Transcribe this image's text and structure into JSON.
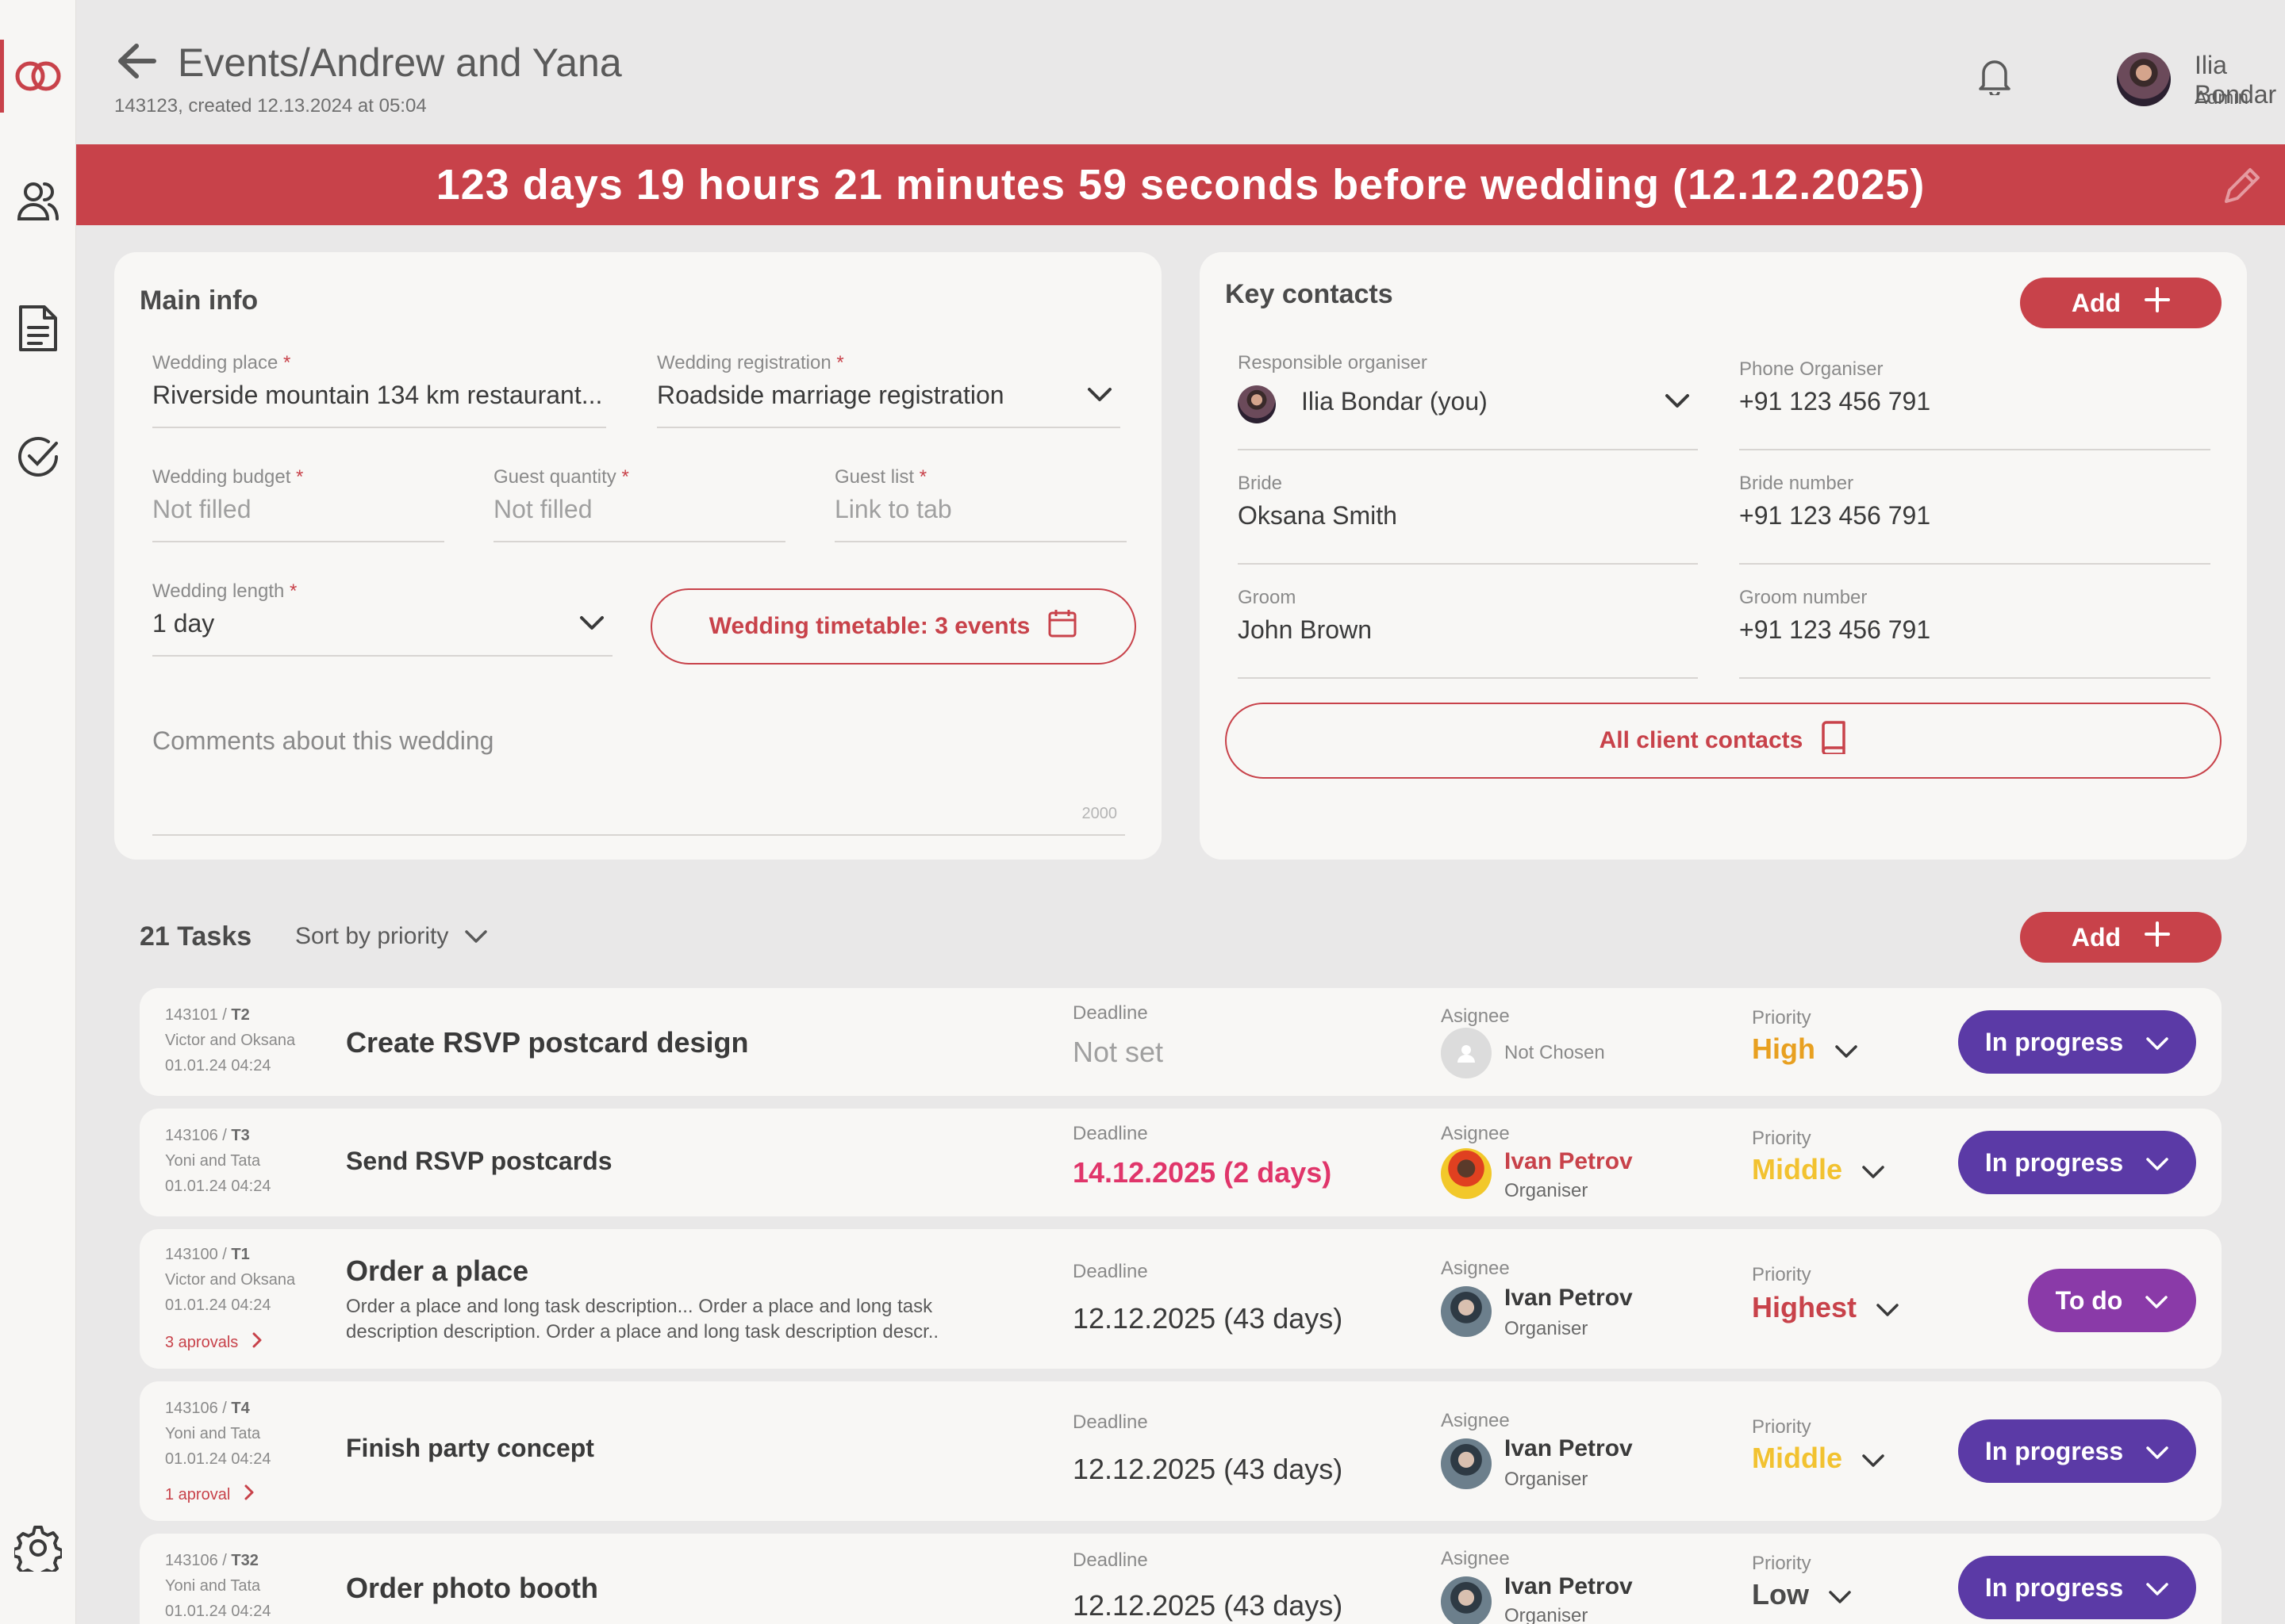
{
  "colors": {
    "accent": "#c8424a",
    "status_in_progress": "#5b3aa6",
    "status_todo": "#8a3aa8",
    "priority_high": "#e8a020",
    "priority_middle": "#f2c230",
    "priority_highest": "#c8424a",
    "priority_low": "#4a4a4a",
    "deadline_urgent": "#e0356a"
  },
  "sidebar": {
    "items": [
      {
        "icon": "rings-logo-icon"
      },
      {
        "icon": "users-icon"
      },
      {
        "icon": "document-icon"
      },
      {
        "icon": "check-circle-icon"
      },
      {
        "icon": "gear-icon"
      }
    ]
  },
  "header": {
    "title": "Events/Andrew and Yana",
    "subtitle": "143123, created 12.13.2024 at 05:04",
    "user_name": "Ilia Bondar",
    "user_role": "Admin"
  },
  "banner": {
    "text": "123 days 19 hours 21 minutes 59 seconds before wedding (12.12.2025)"
  },
  "main_info": {
    "title": "Main info",
    "wedding_place_label": "Wedding place",
    "wedding_place_value": "Riverside mountain 134 km restaurant...",
    "wedding_registration_label": "Wedding registration",
    "wedding_registration_value": "Roadside marriage registration",
    "wedding_budget_label": "Wedding budget",
    "wedding_budget_value": "Not filled",
    "guest_quantity_label": "Guest quantity",
    "guest_quantity_value": "Not filled",
    "guest_list_label": "Guest list",
    "guest_list_value": "Link to tab",
    "wedding_length_label": "Wedding length",
    "wedding_length_value": "1 day",
    "timetable_button": "Wedding timetable: 3 events",
    "comments_placeholder": "Comments about this wedding",
    "comments_max": "2000",
    "required_mark": "*"
  },
  "key_contacts": {
    "title": "Key contacts",
    "add_label": "Add",
    "responsible_label": "Responsible organiser",
    "responsible_value": "Ilia Bondar (you)",
    "phone_organiser_label": "Phone Organiser",
    "phone_organiser_value": "+91 123 456 791",
    "bride_label": "Bride",
    "bride_value": "Oksana Smith",
    "bride_number_label": "Bride number",
    "bride_number_value": "+91 123 456 791",
    "groom_label": "Groom",
    "groom_value": "John Brown",
    "groom_number_label": "Groom number",
    "groom_number_value": "+91 123 456 791",
    "all_contacts_button": "All client contacts"
  },
  "tasks": {
    "count_label": "21 Tasks",
    "sort_label": "Sort by priority",
    "add_label": "Add",
    "deadline_label": "Deadline",
    "assignee_label": "Asignee",
    "priority_label": "Priority",
    "rows": [
      {
        "id": "143101",
        "code": "T2",
        "client": "Victor and Oksana",
        "date": "01.01.24 04:24",
        "title": "Create RSVP postcard design",
        "deadline": "Not set",
        "assignee": "Not Chosen",
        "priority": "High",
        "status": "In progress"
      },
      {
        "id": "143106",
        "code": "T3",
        "client": "Yoni and Tata",
        "date": "01.01.24 04:24",
        "title": "Send RSVP postcards",
        "deadline": "14.12.2025 (2 days)",
        "assignee": "Ivan Petrov",
        "assignee_role": "Organiser",
        "priority": "Middle",
        "status": "In progress"
      },
      {
        "id": "143100",
        "code": "T1",
        "client": "Victor and Oksana",
        "date": "01.01.24 04:24",
        "approvals": "3 aprovals",
        "title": "Order a place",
        "description": "Order a place and long task description... Order a place and long task description description. Order a place and long task description descr..",
        "deadline": "12.12.2025 (43 days)",
        "assignee": "Ivan Petrov",
        "assignee_role": "Organiser",
        "priority": "Highest",
        "status": "To do"
      },
      {
        "id": "143106",
        "code": "T4",
        "client": "Yoni and Tata",
        "date": "01.01.24 04:24",
        "approvals": "1 aproval",
        "title": "Finish party concept",
        "deadline": "12.12.2025 (43 days)",
        "assignee": "Ivan Petrov",
        "assignee_role": "Organiser",
        "priority": "Middle",
        "status": "In progress"
      },
      {
        "id": "143106",
        "code": "T32",
        "client": "Yoni and Tata",
        "date": "01.01.24 04:24",
        "title": "Order photo booth",
        "deadline": "12.12.2025 (43 days)",
        "assignee": "Ivan Petrov",
        "assignee_role": "Organiser",
        "priority": "Low",
        "status": "In progress"
      }
    ]
  }
}
